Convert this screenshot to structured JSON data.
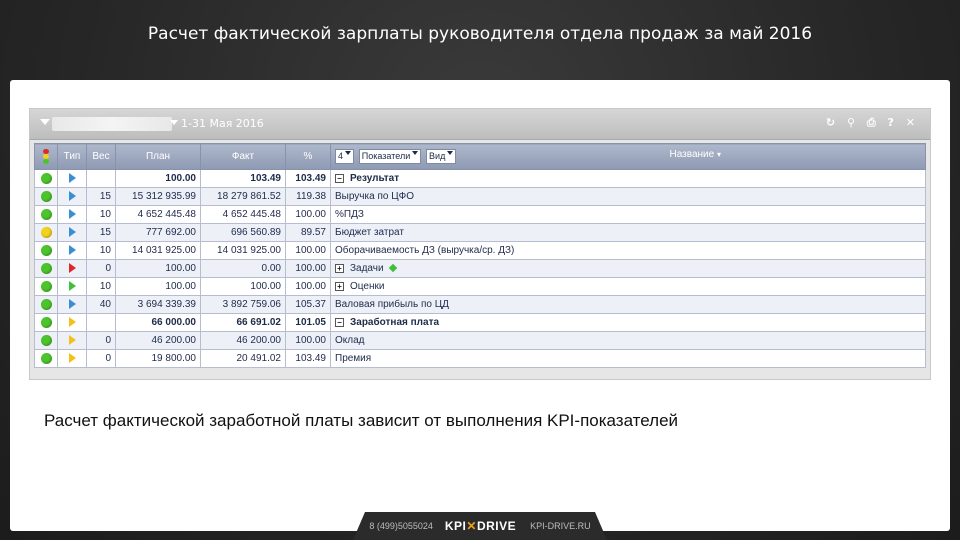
{
  "slide": {
    "title": "Расчет фактической зарплаты руководителя отдела продаж за май 2016",
    "caption": "Расчет фактической заработной платы зависит от выполнения KPI-показателей"
  },
  "widget": {
    "period": "1-31 Мая 2016",
    "tools": [
      "refresh-icon",
      "search-icon",
      "print-icon",
      "help-icon",
      "close-icon"
    ],
    "tool_glyphs": [
      "↻",
      "⚲",
      "⎙",
      "?",
      "✕"
    ]
  },
  "table": {
    "headers": {
      "status": "",
      "type": "Тип",
      "weight": "Вес",
      "plan": "План",
      "fact": "Факт",
      "percent": "%",
      "name": "Название",
      "level_value": "4",
      "filter_value": "Показатели",
      "view_value": "Вид"
    },
    "rows": [
      {
        "status": "green",
        "type": "blue",
        "weight": "",
        "plan": "100.00",
        "fact": "103.49",
        "percent": "103.49",
        "name": "Результат",
        "expander": "minus",
        "bold": true
      },
      {
        "status": "green",
        "type": "blue",
        "weight": "15",
        "plan": "15 312 935.99",
        "fact": "18 279 861.52",
        "percent": "119.38",
        "name": "Выручка по ЦФО",
        "expander": "",
        "bold": false
      },
      {
        "status": "green",
        "type": "blue",
        "weight": "10",
        "plan": "4 652 445.48",
        "fact": "4 652 445.48",
        "percent": "100.00",
        "name": "%ПДЗ",
        "expander": "",
        "bold": false
      },
      {
        "status": "yellow",
        "type": "blue",
        "weight": "15",
        "plan": "777 692.00",
        "fact": "696 560.89",
        "percent": "89.57",
        "name": "Бюджет затрат",
        "expander": "",
        "bold": false
      },
      {
        "status": "green",
        "type": "blue",
        "weight": "10",
        "plan": "14 031 925.00",
        "fact": "14 031 925.00",
        "percent": "100.00",
        "name": "Оборачиваемость ДЗ (выручка/ср. ДЗ)",
        "expander": "",
        "bold": false
      },
      {
        "status": "green",
        "type": "red",
        "weight": "0",
        "plan": "100.00",
        "fact": "0.00",
        "percent": "100.00",
        "name": "Задачи",
        "expander": "plus",
        "bold": false,
        "diamond": true
      },
      {
        "status": "green",
        "type": "green",
        "weight": "10",
        "plan": "100.00",
        "fact": "100.00",
        "percent": "100.00",
        "name": "Оценки",
        "expander": "plus",
        "bold": false
      },
      {
        "status": "green",
        "type": "blue",
        "weight": "40",
        "plan": "3 694 339.39",
        "fact": "3 892 759.06",
        "percent": "105.37",
        "name": "Валовая прибыль по ЦД",
        "expander": "",
        "bold": false
      },
      {
        "status": "green",
        "type": "yellow",
        "weight": "",
        "plan": "66 000.00",
        "fact": "66 691.02",
        "percent": "101.05",
        "name": "Заработная плата",
        "expander": "minus",
        "bold": true
      },
      {
        "status": "green",
        "type": "yellow",
        "weight": "0",
        "plan": "46 200.00",
        "fact": "46 200.00",
        "percent": "100.00",
        "name": "Оклад",
        "expander": "",
        "bold": false
      },
      {
        "status": "green",
        "type": "yellow",
        "weight": "0",
        "plan": "19 800.00",
        "fact": "20 491.02",
        "percent": "103.49",
        "name": "Премия",
        "expander": "",
        "bold": false
      }
    ]
  },
  "footer": {
    "phone": "8 (499)5055024",
    "logo_left": "KPI",
    "logo_mid": "✕",
    "logo_right": "DRIVE",
    "site": "KPI-DRIVE.RU"
  },
  "colors": {
    "green": "#4cc42c",
    "yellow": "#f2d21b",
    "blue": "#3a8fd4",
    "red": "#e02828",
    "flag_green": "#3fbf3a",
    "flag_yellow": "#f2c21b"
  }
}
